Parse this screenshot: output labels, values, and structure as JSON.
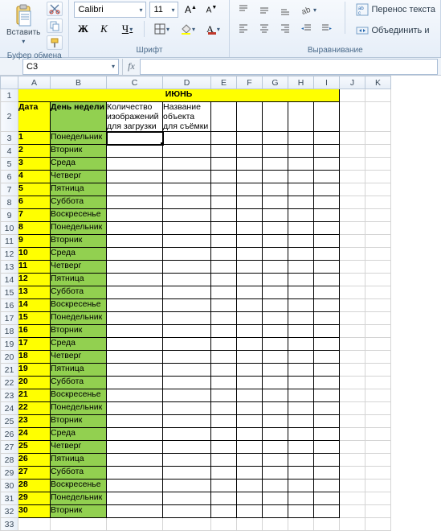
{
  "ribbon": {
    "clipboard": {
      "paste": "Вставить",
      "group": "Буфер обмена"
    },
    "font": {
      "name": "Calibri",
      "size": "11",
      "bold": "Ж",
      "italic": "К",
      "underline": "Ч",
      "group": "Шрифт"
    },
    "align": {
      "wrap": "Перенос текста",
      "merge": "Объединить и",
      "group": "Выравнивание"
    }
  },
  "namebox": "C3",
  "fx": "fx",
  "columns": [
    "A",
    "B",
    "C",
    "D",
    "E",
    "F",
    "G",
    "H",
    "I",
    "J",
    "K"
  ],
  "sheet": {
    "title": "ИЮНЬ",
    "headers": {
      "date": "Дата",
      "weekday": "День недели",
      "imgcount": "Количество изображений для загрузки",
      "objname": "Название объекта для съёмки"
    },
    "rows": [
      {
        "n": "1",
        "d": "Понедельник"
      },
      {
        "n": "2",
        "d": "Вторник"
      },
      {
        "n": "3",
        "d": "Среда"
      },
      {
        "n": "4",
        "d": "Четверг"
      },
      {
        "n": "5",
        "d": "Пятница"
      },
      {
        "n": "6",
        "d": "Суббота"
      },
      {
        "n": "7",
        "d": "Воскресенье"
      },
      {
        "n": "8",
        "d": "Понедельник"
      },
      {
        "n": "9",
        "d": "Вторник"
      },
      {
        "n": "10",
        "d": "Среда"
      },
      {
        "n": "11",
        "d": "Четверг"
      },
      {
        "n": "12",
        "d": "Пятница"
      },
      {
        "n": "13",
        "d": "Суббота"
      },
      {
        "n": "14",
        "d": "Воскресенье"
      },
      {
        "n": "15",
        "d": "Понедельник"
      },
      {
        "n": "16",
        "d": "Вторник"
      },
      {
        "n": "17",
        "d": "Среда"
      },
      {
        "n": "18",
        "d": "Четверг"
      },
      {
        "n": "19",
        "d": "Пятница"
      },
      {
        "n": "20",
        "d": "Суббота"
      },
      {
        "n": "21",
        "d": "Воскресенье"
      },
      {
        "n": "22",
        "d": "Понедельник"
      },
      {
        "n": "23",
        "d": "Вторник"
      },
      {
        "n": "24",
        "d": "Среда"
      },
      {
        "n": "25",
        "d": "Четверг"
      },
      {
        "n": "26",
        "d": "Пятница"
      },
      {
        "n": "27",
        "d": "Суббота"
      },
      {
        "n": "28",
        "d": "Воскресенье"
      },
      {
        "n": "29",
        "d": "Понедельник"
      },
      {
        "n": "30",
        "d": "Вторник"
      }
    ]
  }
}
